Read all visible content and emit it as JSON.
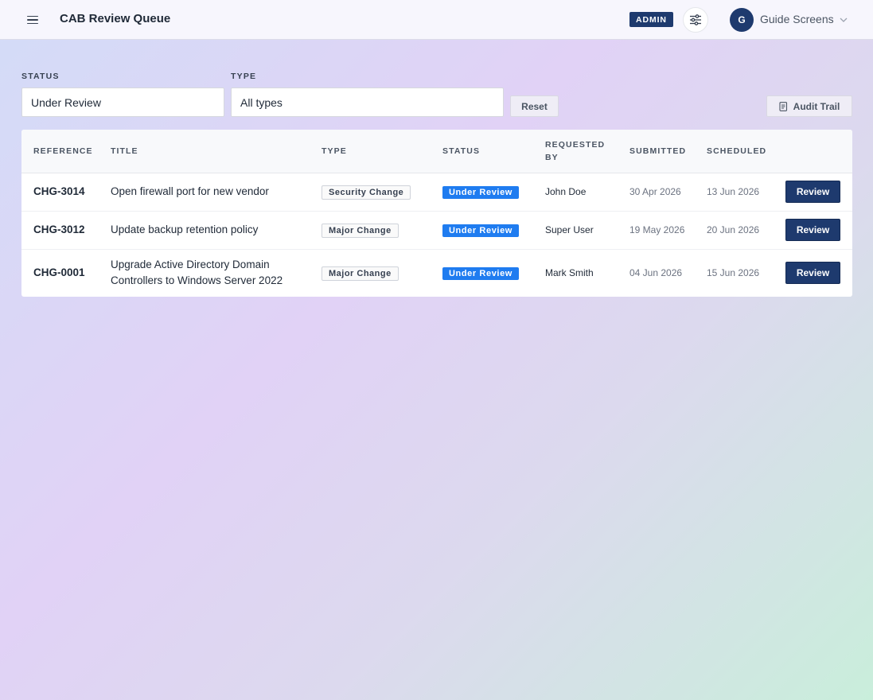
{
  "header": {
    "title": "CAB Review Queue",
    "admin_badge": "ADMIN",
    "user": {
      "initial": "G",
      "name": "Guide Screens"
    },
    "icons": {
      "menu": "hamburger-menu-icon",
      "settings": "sliders-icon",
      "user_menu": "chevron-down-icon"
    }
  },
  "filters": {
    "status": {
      "label": "STATUS",
      "value": "Under Review"
    },
    "type": {
      "label": "TYPE",
      "value": "All types"
    },
    "reset_label": "Reset",
    "audit_trail_label": "Audit Trail"
  },
  "table": {
    "columns": [
      "REFERENCE",
      "TITLE",
      "TYPE",
      "STATUS",
      "REQUESTED BY",
      "SUBMITTED",
      "SCHEDULED",
      ""
    ],
    "rows": [
      {
        "reference": "CHG-3014",
        "title": "Open firewall port for new vendor",
        "type": "Security Change",
        "status": "Under Review",
        "requested_by": "John Doe",
        "submitted": "30 Apr 2026",
        "scheduled": "13 Jun 2026",
        "action": "Review"
      },
      {
        "reference": "CHG-3012",
        "title": "Update backup retention policy",
        "type": "Major Change",
        "status": "Under Review",
        "requested_by": "Super User",
        "submitted": "19 May 2026",
        "scheduled": "20 Jun 2026",
        "action": "Review"
      },
      {
        "reference": "CHG-0001",
        "title": "Upgrade Active Directory Domain Controllers to Windows Server 2022",
        "type": "Major Change",
        "status": "Under Review",
        "requested_by": "Mark Smith",
        "submitted": "04 Jun 2026",
        "scheduled": "15 Jun 2026",
        "action": "Review"
      }
    ]
  },
  "colors": {
    "primary": "#1e3a6e",
    "status_blue": "#1f7cf0"
  }
}
